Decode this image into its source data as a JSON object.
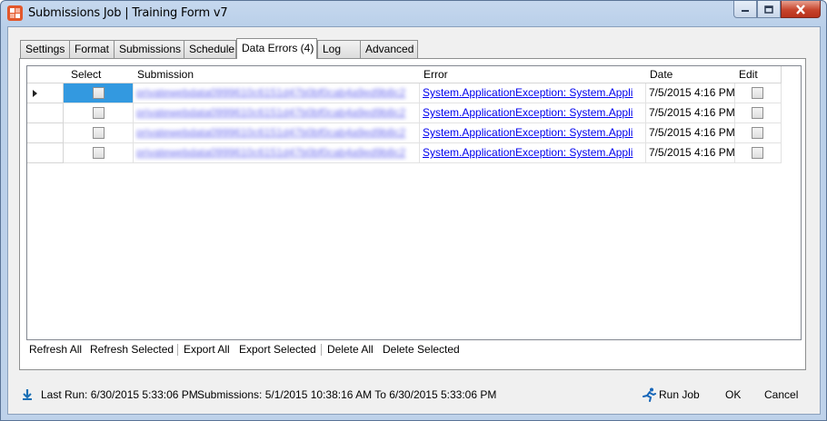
{
  "window": {
    "title": "Submissions Job | Training Form v7",
    "icons": [
      "app-logo-icon",
      "minimize-icon",
      "maximize-icon",
      "close-icon"
    ]
  },
  "tabs": [
    {
      "label": "Settings"
    },
    {
      "label": "Format"
    },
    {
      "label": "Submissions"
    },
    {
      "label": "Schedule"
    },
    {
      "label": "Data Errors (4)"
    },
    {
      "label": "Log"
    },
    {
      "label": "Advanced"
    }
  ],
  "grid": {
    "columns": {
      "select": "Select",
      "submission": "Submission",
      "error": "Error",
      "date": "Date",
      "edit": "Edit"
    },
    "rows": [
      {
        "submission": "privatewebdata0999610c6151d47b0bf0cab4a9ed9b8c2",
        "error": "System.ApplicationException: System.Appli",
        "date": "7/5/2015 4:16 PM"
      },
      {
        "submission": "privatewebdata0999610c6151d47b0bf0cab4a9ed9b8c2",
        "error": "System.ApplicationException: System.Appli",
        "date": "7/5/2015 4:16 PM"
      },
      {
        "submission": "privatewebdata0999610c6151d47b0bf0cab4a9ed9b8c2",
        "error": "System.ApplicationException: System.Appli",
        "date": "7/5/2015 4:16 PM"
      },
      {
        "submission": "privatewebdata0999610c6151d47b0bf0cab4a9ed9b8c2",
        "error": "System.ApplicationException: System.Appli",
        "date": "7/5/2015 4:16 PM"
      }
    ]
  },
  "actions": {
    "refresh_all": "Refresh All",
    "refresh_selected": "Refresh Selected",
    "export_all": "Export All",
    "export_selected": "Export Selected",
    "delete_all": "Delete All",
    "delete_selected": "Delete Selected"
  },
  "footer": {
    "last_run": "Last Run: 6/30/2015 5:33:06 PM",
    "submissions": "Submissions: 5/1/2015 10:38:16 AM To 6/30/2015 5:33:06 PM",
    "run_job": "Run Job",
    "ok": "OK",
    "cancel": "Cancel"
  },
  "colors": {
    "accent_selection": "#3399e0",
    "link": "#0000ee",
    "title_gradient": "#c6d8ee"
  }
}
